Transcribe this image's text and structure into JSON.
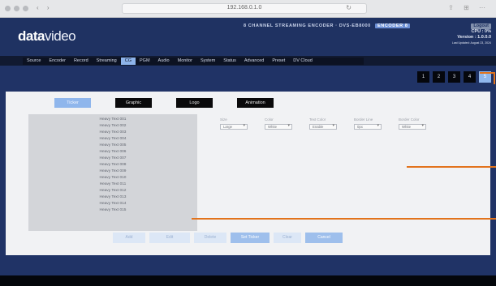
{
  "browser": {
    "url": "192.168.0.1.0"
  },
  "header": {
    "brand": "data",
    "brand_suffix": "video",
    "product_title": "8 CHANNEL STREAMING ENCODER · DVS-EB8000",
    "product_badge": "ENCODER 8",
    "status_pill": "Logout",
    "status_line1": "CPU : 0%",
    "status_line2": "Version : 1.0.0.0",
    "status_line3": "Last Updated: August 23, 2024"
  },
  "menu": {
    "items": [
      "Source",
      "Encoder",
      "Record",
      "Streaming",
      "CG",
      "PGM",
      "Audio",
      "Monitor",
      "System",
      "Status",
      "Advanced",
      "Preset",
      "DV Cloud"
    ],
    "active_index": 4
  },
  "pages": {
    "items": [
      "1",
      "2",
      "3",
      "4",
      "5"
    ],
    "selected_index": 4
  },
  "tabs": {
    "items": [
      "Ticker",
      "Graphic",
      "Logo",
      "Animation"
    ],
    "active_index": 0
  },
  "ticker_list": {
    "items": [
      "Heavy Text 001",
      "Heavy Text 002",
      "Heavy Text 003",
      "Heavy Text 004",
      "Heavy Text 005",
      "Heavy Text 006",
      "Heavy Text 007",
      "Heavy Text 008",
      "Heavy Text 009",
      "Heavy Text 010",
      "Heavy Text 011",
      "Heavy Text 012",
      "Heavy Text 013",
      "Heavy Text 014",
      "Heavy Text 015"
    ]
  },
  "fields": [
    {
      "label": "Size",
      "value": "Large"
    },
    {
      "label": "Color",
      "value": "White"
    },
    {
      "label": "Text Color",
      "value": "Enable"
    },
    {
      "label": "Border Line",
      "value": "0px"
    },
    {
      "label": "Border Color",
      "value": "White"
    }
  ],
  "actions": {
    "items": [
      "Add",
      "Edit",
      "Delete",
      "Set Ticker",
      "Clear",
      "Cancel"
    ],
    "highlighted": [
      3,
      5
    ]
  },
  "colors": {
    "header_bg": "#1f3262",
    "accent": "#8fb6ec",
    "callout": "#e2731c"
  }
}
